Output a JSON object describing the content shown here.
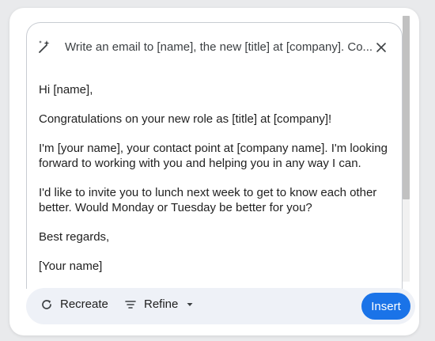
{
  "prompt": {
    "icon": "magic-wand-icon",
    "text": "Write an email to [name], the new [title] at [company]. Co...",
    "close_icon": "close-icon"
  },
  "email": {
    "greeting": "Hi [name],",
    "paragraphs": [
      "Congratulations on your new role as [title] at [company]!",
      "I'm [your name], your contact point at [company name]. I'm looking forward to working with you and helping you in any way I can.",
      "I'd like to invite you to lunch next week to get to know each other better. Would Monday or Tuesday be better for you?"
    ],
    "signoff": "Best regards,",
    "signature": "[Your name]"
  },
  "actions": {
    "recreate_label": "Recreate",
    "recreate_icon": "refresh-icon",
    "refine_label": "Refine",
    "refine_icon": "filter-lines-icon",
    "refine_caret_icon": "caret-down-icon",
    "insert_label": "Insert"
  },
  "colors": {
    "accent": "#1a73e8",
    "action_bar_bg": "#eef1f7"
  }
}
